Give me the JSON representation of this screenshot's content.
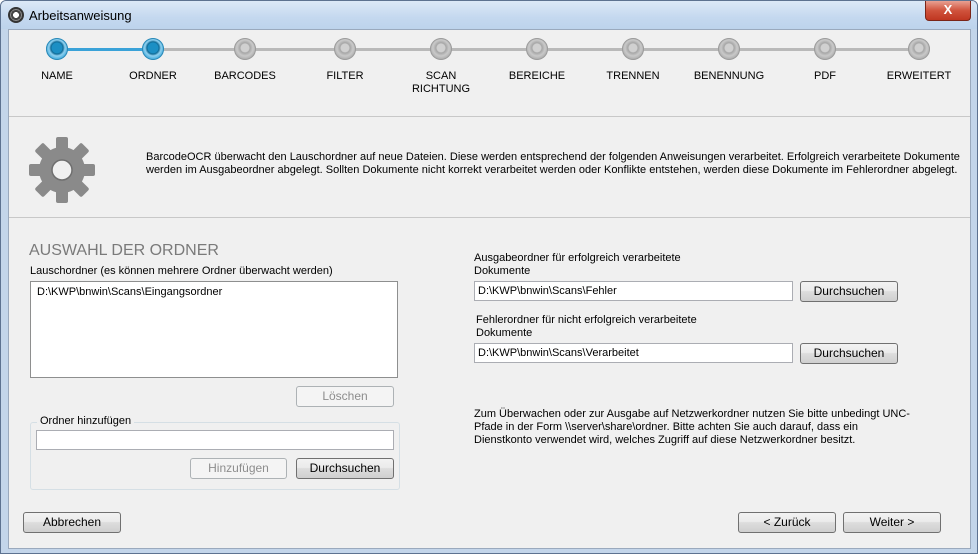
{
  "window": {
    "title": "Arbeitsanweisung",
    "close_label": "X"
  },
  "wizard": {
    "steps": [
      {
        "label": "NAME",
        "state": "done"
      },
      {
        "label": "ORDNER",
        "state": "active"
      },
      {
        "label": "BARCODES",
        "state": "pending"
      },
      {
        "label": "FILTER",
        "state": "pending"
      },
      {
        "label": "SCAN RICHTUNG",
        "state": "pending"
      },
      {
        "label": "BEREICHE",
        "state": "pending"
      },
      {
        "label": "TRENNEN",
        "state": "pending"
      },
      {
        "label": "BENENNUNG",
        "state": "pending"
      },
      {
        "label": "PDF",
        "state": "pending"
      },
      {
        "label": "ERWEITERT",
        "state": "pending"
      }
    ]
  },
  "info": {
    "text": "BarcodeOCR überwacht den Lauschordner auf neue Dateien. Diese werden entsprechend der folgenden Anweisungen verarbeitet. Erfolgreich verarbeitete Dokumente werden im Ausgabeordner abgelegt. Sollten Dokumente nicht korrekt verarbeitet werden oder Konflikte entstehen, werden diese Dokumente im Fehlerordner abgelegt."
  },
  "section": {
    "title": "AUSWAHL DER ORDNER"
  },
  "watch": {
    "label": "Lauschordner (es können mehrere Ordner überwacht werden)",
    "items": [
      "D:\\KWP\\bnwin\\Scans\\Eingangsordner"
    ],
    "delete_label": "Löschen"
  },
  "add_folder": {
    "title": "Ordner hinzufügen",
    "value": "",
    "add_label": "Hinzufügen",
    "browse_label": "Durchsuchen"
  },
  "output": {
    "label": "Ausgabeordner für erfolgreich verarbeitete Dokumente",
    "value": "D:\\KWP\\bnwin\\Scans\\Fehler",
    "browse_label": "Durchsuchen"
  },
  "error": {
    "label": "Fehlerordner für nicht erfolgreich verarbeitete Dokumente",
    "value": "D:\\KWP\\bnwin\\Scans\\Verarbeitet",
    "browse_label": "Durchsuchen"
  },
  "note": "Zum Überwachen oder zur Ausgabe auf Netzwerkordner nutzen Sie bitte unbedingt UNC-Pfade in der Form \\\\server\\share\\ordner. Bitte achten Sie auch darauf, dass ein Dienstkonto verwendet wird, welches Zugriff auf diese Netzwerkordner besitzt.",
  "footer": {
    "cancel_label": "Abbrechen",
    "back_label": "< Zurück",
    "next_label": "Weiter >"
  },
  "colors": {
    "accent": "#3aa2d8",
    "close": "#c9452f"
  }
}
